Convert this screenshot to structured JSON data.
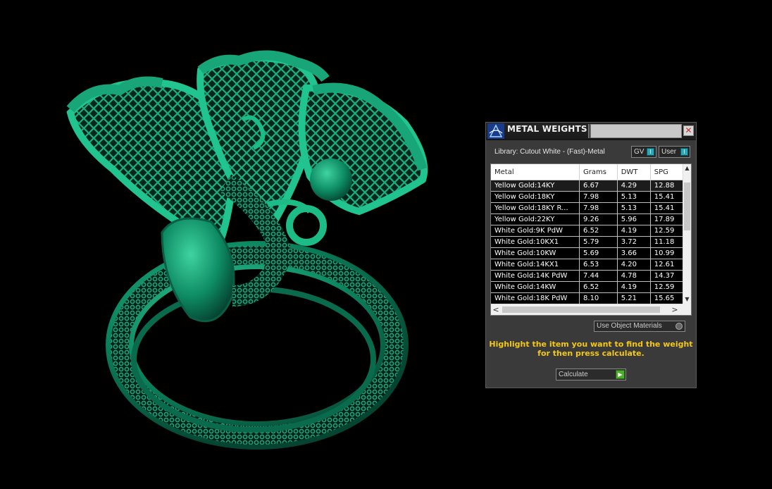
{
  "panel": {
    "title": "METAL WEIGHTS",
    "close_glyph": "✕",
    "library_label": "Library: Cutout White - (Fast)-Metal",
    "toggles": [
      {
        "label": "GV",
        "knob": "I"
      },
      {
        "label": "User",
        "knob": "I"
      }
    ],
    "table": {
      "columns": [
        "Metal",
        "Grams",
        "DWT",
        "SPG"
      ],
      "rows": [
        [
          "Yellow Gold:14KY",
          "6.67",
          "4.29",
          "12.88"
        ],
        [
          "Yellow Gold:18KY",
          "7.98",
          "5.13",
          "15.41"
        ],
        [
          "Yellow Gold:18KY R...",
          "7.98",
          "5.13",
          "15.41"
        ],
        [
          "Yellow Gold:22KY",
          "9.26",
          "5.96",
          "17.89"
        ],
        [
          "White Gold:9K PdW",
          "6.52",
          "4.19",
          "12.59"
        ],
        [
          "White Gold:10KX1",
          "5.79",
          "3.72",
          "11.18"
        ],
        [
          "White Gold:10KW",
          "5.69",
          "3.66",
          "10.99"
        ],
        [
          "White Gold:14KX1",
          "6.53",
          "4.20",
          "12.61"
        ],
        [
          "White Gold:14K PdW",
          "7.44",
          "4.78",
          "14.37"
        ],
        [
          "White Gold:14KW",
          "6.52",
          "4.19",
          "12.59"
        ],
        [
          "White Gold:18K PdW",
          "8.10",
          "5.21",
          "15.65"
        ]
      ]
    },
    "scroll_up": "▲",
    "scroll_down": "▼",
    "scroll_left": "<",
    "scroll_right": ">",
    "use_object_materials": "Use Object Materials",
    "instructions_line1": "Highlight the item you want to find the weight",
    "instructions_line2": "for then press calculate.",
    "calculate_label": "Calculate",
    "calculate_glyph": "▶"
  },
  "icons": {
    "app_logo": "app-logo-icon",
    "close": "close-icon",
    "render": "ring-model"
  },
  "colors": {
    "background": "#000000",
    "model_green": "#0d8a62",
    "instruction_yellow": "#f3c81a",
    "toggle_cyan": "#2aa8b8",
    "go_green": "#4cae2a"
  }
}
